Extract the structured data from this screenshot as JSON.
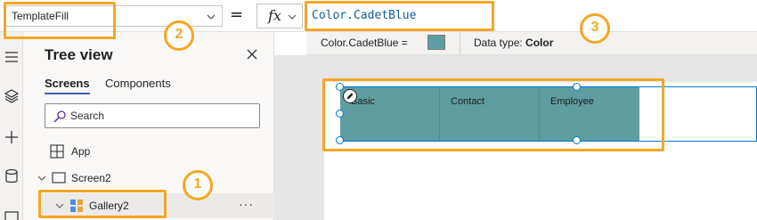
{
  "formula_bar": {
    "property_value": "TemplateFill",
    "equals_sign": "=",
    "fx_label": "fx",
    "formula_text": "Color.CadetBlue"
  },
  "result_strip": {
    "expression": "Color.CadetBlue  =",
    "swatch_color": "#5f9ea0",
    "data_type_label": "Data type:",
    "data_type_value": "Color"
  },
  "tree_view": {
    "title": "Tree view",
    "tabs": [
      {
        "label": "Screens",
        "active": true
      },
      {
        "label": "Components",
        "active": false
      }
    ],
    "search_placeholder": "Search",
    "app_label": "App",
    "screen_label": "Screen2",
    "gallery_label": "Gallery2",
    "more_label": "···"
  },
  "left_rail": {
    "icons": [
      "hamburger-icon",
      "layers-icon",
      "plus-icon",
      "database-icon",
      "media-icon"
    ]
  },
  "gallery": {
    "fill_color": "#5f9ea0",
    "items": [
      "Basic",
      "Contact",
      "Employee"
    ]
  },
  "callouts": {
    "one": "1",
    "two": "2",
    "three": "3",
    "color": "#f5a623"
  },
  "colors": {
    "accent": "#0078d4",
    "formula_text": "#0e5f9c"
  }
}
